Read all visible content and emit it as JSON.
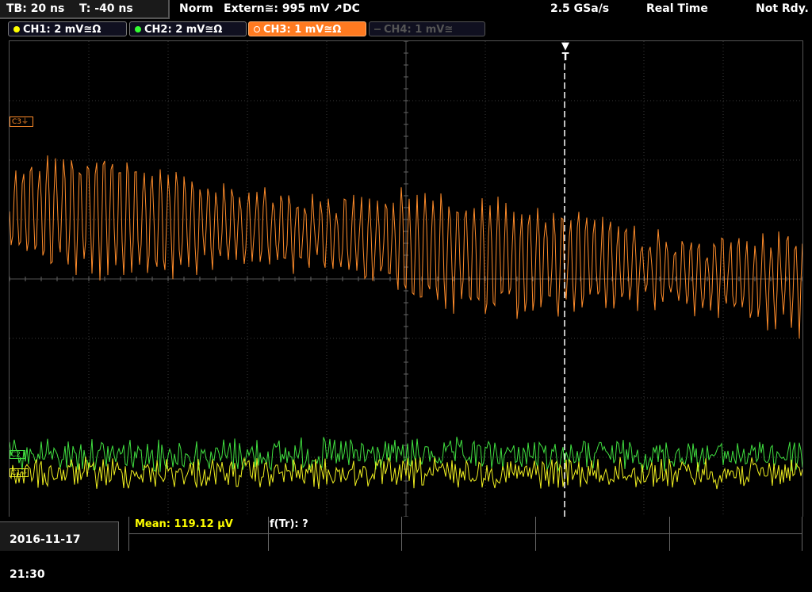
{
  "status": {
    "timebase": "TB: 20 ns",
    "trigger_time": "T: -40 ns",
    "trigger_mode": "Norm",
    "trigger_source": "Extern≅: 995 mV ↗DC",
    "sample_rate": "2.5 GSa/s",
    "acq_mode": "Real Time",
    "ready": "Not Rdy."
  },
  "channels": [
    {
      "label": "CH1: 2 mV≅Ω",
      "color": "#ffff00",
      "active": true
    },
    {
      "label": "CH2: 2 mV≅Ω",
      "color": "#33ff33",
      "active": true
    },
    {
      "label": "CH3: 1 mV≅Ω",
      "color": "#ff8c2a",
      "active": true,
      "selected": true
    },
    {
      "label": "CH4: 1 mV≅",
      "color": "#666666",
      "active": false
    }
  ],
  "markers": {
    "ch3": "C3⏚",
    "ch2": "C2",
    "ch1": "C1⏚",
    "trigger": "T"
  },
  "footer": {
    "datetime": "2016-11-17 21:30",
    "measurement_mean": "Mean: 119.12 µV",
    "measurement_freq": "f(Tr): ?"
  },
  "colors": {
    "ch1": "#f0f020",
    "ch2": "#40e040",
    "ch3": "#ff8c2a",
    "grid": "#3a3a3a",
    "trigger_line": "#ffffff"
  }
}
